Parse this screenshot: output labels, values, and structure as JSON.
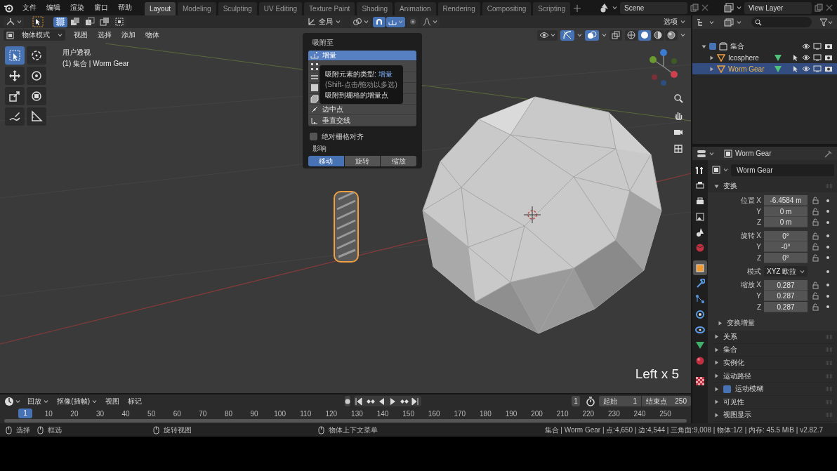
{
  "menubar": {
    "menus": [
      "文件",
      "编辑",
      "渲染",
      "窗口",
      "帮助"
    ]
  },
  "workspace_tabs": [
    {
      "label": "Layout",
      "selected": true
    },
    {
      "label": "Modeling",
      "selected": false
    },
    {
      "label": "Sculpting",
      "selected": false
    },
    {
      "label": "UV Editing",
      "selected": false
    },
    {
      "label": "Texture Paint",
      "selected": false
    },
    {
      "label": "Shading",
      "selected": false
    },
    {
      "label": "Animation",
      "selected": false
    },
    {
      "label": "Rendering",
      "selected": false
    },
    {
      "label": "Compositing",
      "selected": false
    },
    {
      "label": "Scripting",
      "selected": false
    }
  ],
  "scene": {
    "name": "Scene"
  },
  "view_layer": {
    "name": "View Layer"
  },
  "viewport": {
    "orientation": "全局",
    "options": "选项",
    "mode": "物体模式",
    "menus": [
      "视图",
      "选择",
      "添加",
      "物体"
    ],
    "overlay_text": [
      "用户透视",
      "(1) 集合 | Worm Gear"
    ],
    "key_hint": "Left x 5",
    "snap_popover": {
      "title": "吸附至",
      "elements": [
        {
          "label": "增量",
          "selected": true
        },
        {
          "selected": false
        },
        {
          "selected": false
        },
        {
          "selected": false
        },
        {
          "selected": false
        },
        {
          "label": "边中点",
          "selected": false
        },
        {
          "label": "垂直交线",
          "selected": false
        }
      ],
      "tooltip": {
        "title": "吸附元素的类型:",
        "value": "增量",
        "hint": "(Shift-点击/拖动以多选)",
        "description": "吸附到栅格的增量点"
      },
      "absolute_grid": {
        "label": "绝对栅格对齐",
        "checked": false
      },
      "affect": {
        "title": "影响",
        "options": [
          {
            "label": "移动",
            "selected": true
          },
          {
            "label": "旋转",
            "selected": false
          },
          {
            "label": "缩放",
            "selected": false
          }
        ]
      }
    }
  },
  "outliner": {
    "items": [
      {
        "name": "集合",
        "expanded": true,
        "checked": true,
        "children": [
          {
            "name": "Icosphere",
            "expanded": false,
            "selected": false
          },
          {
            "name": "Worm Gear",
            "expanded": false,
            "selected": true
          }
        ]
      }
    ]
  },
  "properties": {
    "object_name": "Worm Gear",
    "datablock": "Worm Gear",
    "tabs": [
      {
        "selected": false
      },
      {
        "selected": false
      },
      {
        "selected": false
      },
      {
        "selected": false
      },
      {
        "selected": false
      },
      {
        "selected": false
      },
      {
        "selected": true
      },
      {
        "selected": false
      },
      {
        "selected": false
      },
      {
        "selected": false
      },
      {
        "selected": false
      },
      {
        "selected": false
      },
      {
        "selected": false
      },
      {
        "selected": false
      }
    ],
    "transform": {
      "title": "变换",
      "expanded": true,
      "rows": [
        {
          "kind": "field",
          "label": "位置 X",
          "value": "-6.4584 m"
        },
        {
          "kind": "field",
          "label": "Y",
          "value": "0 m"
        },
        {
          "kind": "field",
          "label": "Z",
          "value": "0 m"
        },
        {
          "kind": "gap"
        },
        {
          "kind": "field",
          "label": "旋转 X",
          "value": "0°"
        },
        {
          "kind": "field",
          "label": "Y",
          "value": "-0°"
        },
        {
          "kind": "field",
          "label": "Z",
          "value": "0°"
        },
        {
          "kind": "dropdown",
          "label": "模式",
          "value": "XYZ 欧拉"
        },
        {
          "kind": "field",
          "label": "缩放 X",
          "value": "0.287"
        },
        {
          "kind": "field",
          "label": "Y",
          "value": "0.287"
        },
        {
          "kind": "field",
          "label": "Z",
          "value": "0.287"
        }
      ],
      "delta": {
        "title": "变换增量",
        "expanded": false
      }
    },
    "panels": [
      {
        "kind": "plain",
        "title": "关系",
        "expanded": false
      },
      {
        "kind": "plain",
        "title": "集合",
        "expanded": false
      },
      {
        "kind": "plain",
        "title": "实例化",
        "expanded": false
      },
      {
        "kind": "plain",
        "title": "运动路径",
        "expanded": false
      },
      {
        "kind": "checkbox",
        "title": "运动模糊",
        "expanded": false,
        "checked": true
      },
      {
        "kind": "plain",
        "title": "可见性",
        "expanded": false
      },
      {
        "kind": "plain",
        "title": "视图显示",
        "expanded": false
      }
    ]
  },
  "timeline": {
    "menus": [
      {
        "label": "回放",
        "dropdown": true
      },
      {
        "label": "抠像(插帧)",
        "dropdown": true
      },
      {
        "label": "视图",
        "dropdown": false
      },
      {
        "label": "标记",
        "dropdown": false
      }
    ],
    "current_frame": "1",
    "start_label": "起始",
    "start": "1",
    "end_label": "结束点",
    "end": "250",
    "playhead": "1",
    "ticks": [
      "10",
      "20",
      "30",
      "40",
      "50",
      "60",
      "70",
      "80",
      "90",
      "100",
      "110",
      "120",
      "130",
      "140",
      "150",
      "160",
      "170",
      "180",
      "190",
      "200",
      "210",
      "220",
      "230",
      "240",
      "250"
    ]
  },
  "status_bar": {
    "hints": [
      "选择",
      "框选",
      "旋转视图",
      "物体上下文菜单"
    ],
    "stats": "集合 | Worm Gear | 点:4,650 | 边:4,544 | 三角面:9,008 | 物体:1/2 | 内存: 45.5 MiB | v2.82.7"
  }
}
